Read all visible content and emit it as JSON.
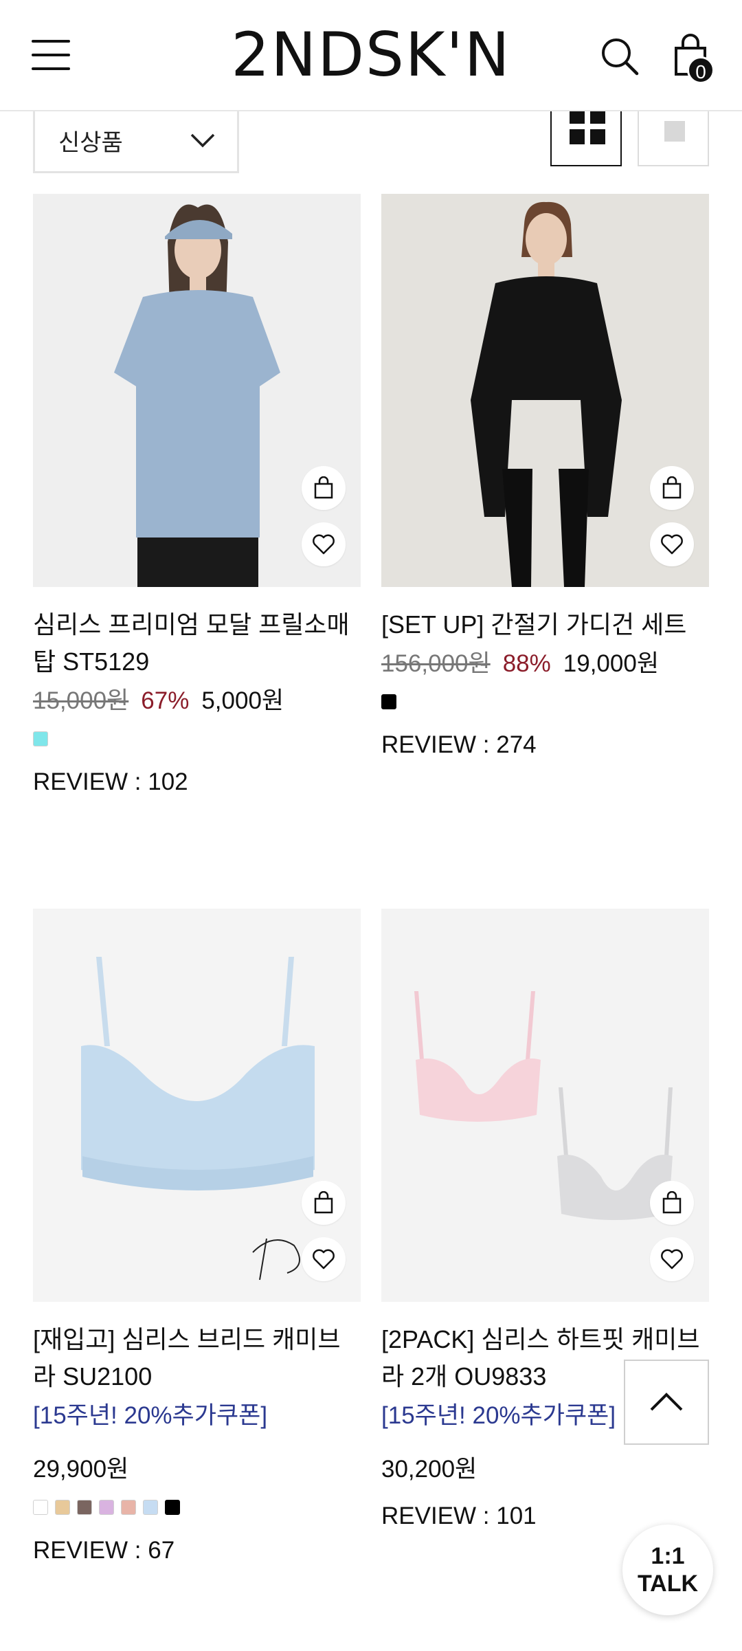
{
  "header": {
    "logo": "2NDSK'N",
    "cart_count": "0"
  },
  "sort": {
    "selected": "신상품"
  },
  "products": [
    {
      "name": "심리스 프리미엄 모달 프릴소매탑 ST5129",
      "original_price": "15,000원",
      "discount": "67%",
      "price": "5,000원",
      "swatches": [
        "#7fe6ea"
      ],
      "review": "REVIEW : 102"
    },
    {
      "name": "[SET UP] 간절기 가디건 세트",
      "original_price": "156,000원",
      "discount": "88%",
      "price": "19,000원",
      "swatches": [
        "#000000"
      ],
      "review": "REVIEW : 274"
    },
    {
      "name": "[재입고] 심리스 브리드 캐미브라 SU2100",
      "promo": "[15주년! 20%추가쿠폰]",
      "price": "29,900원",
      "swatches": [
        "#ffffff",
        "#e8c99a",
        "#7a6560",
        "#d9b3e0",
        "#e8b4a8",
        "#c6dcf2",
        "#000000"
      ],
      "review": "REVIEW : 67"
    },
    {
      "name": "[2PACK] 심리스 하트핏 캐미브라 2개 OU9833",
      "promo": "[15주년! 20%추가쿠폰]",
      "price": "30,200원",
      "review": "REVIEW : 101"
    }
  ],
  "talk": {
    "line1": "1:1",
    "line2": "TALK"
  },
  "colors": {
    "discount": "#8b1d2a",
    "promo": "#2b3990"
  }
}
